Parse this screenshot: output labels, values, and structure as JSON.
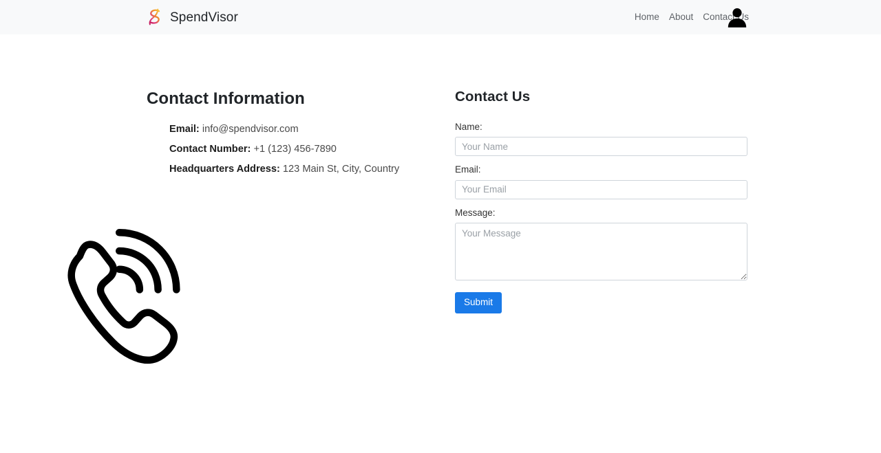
{
  "header": {
    "brand_name": "SpendVisor",
    "brand_logo_icon": "spendvisor-s-logo",
    "nav_links": [
      {
        "label": "Home"
      },
      {
        "label": "About"
      },
      {
        "label": "Contact Us"
      }
    ],
    "avatar_icon": "user-avatar-icon",
    "background_color": "#f8f9fa"
  },
  "contact_information": {
    "heading": "Contact Information",
    "items": [
      {
        "label": "Email:",
        "value": "info@spendvisor.com"
      },
      {
        "label": "Contact Number:",
        "value": "+1 (123) 456-7890"
      },
      {
        "label": "Headquarters Address:",
        "value": "123 Main St, City, Country"
      }
    ],
    "illustration_icon": "phone-call-icon"
  },
  "contact_form": {
    "heading": "Contact Us",
    "name_label": "Name:",
    "name_placeholder": "Your Name",
    "name_value": "",
    "email_label": "Email:",
    "email_placeholder": "Your Email",
    "email_value": "",
    "message_label": "Message:",
    "message_placeholder": "Your Message",
    "message_value": "",
    "submit_label": "Submit",
    "submit_color": "#1a7ae8"
  }
}
